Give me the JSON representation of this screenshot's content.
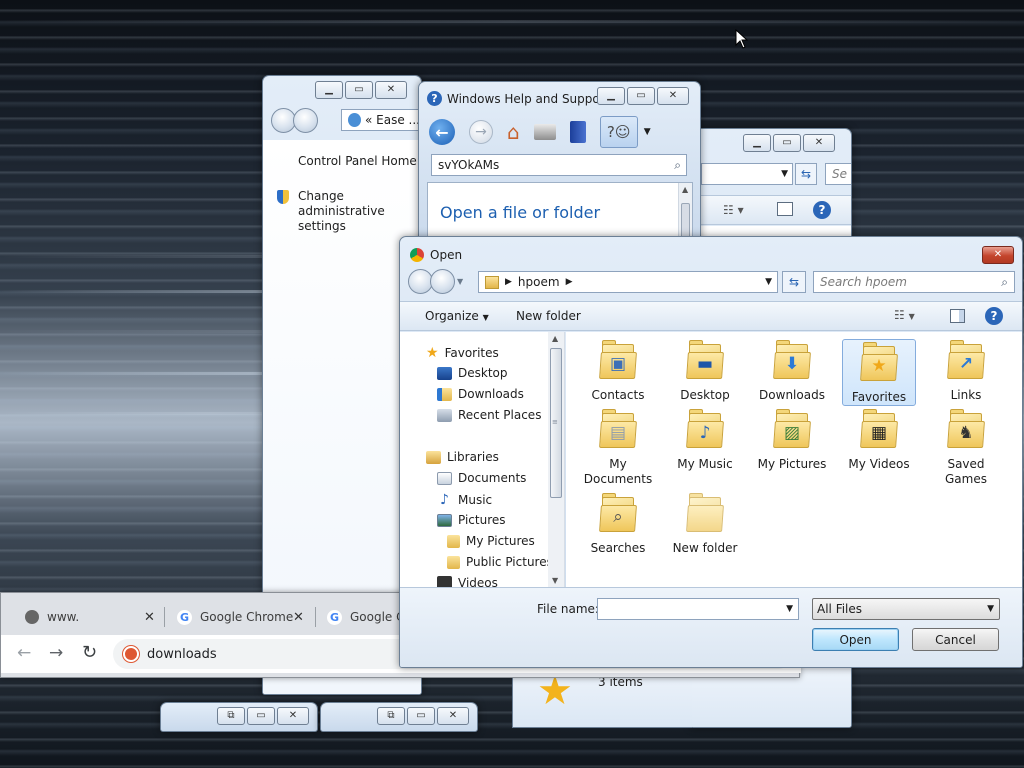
{
  "desktop": {
    "cursor": "arrow-cursor"
  },
  "control_panel": {
    "address": "Ease ...",
    "address_prefix": "«",
    "sidebar_home": "Control Panel Home",
    "sidebar_link": "Change administrative settings"
  },
  "help_window": {
    "title": "Windows Help and Support",
    "search_value": "svYOkAMs",
    "heading": "Open a file or folder"
  },
  "explorer_back": {
    "search_placeholder": "Se",
    "status": "3 items"
  },
  "open_dialog": {
    "title": "Open",
    "breadcrumb": "hpoem",
    "search_placeholder": "Search hpoem",
    "toolbar": {
      "organize": "Organize",
      "new_folder": "New folder"
    },
    "nav": {
      "favorites": "Favorites",
      "desktop": "Desktop",
      "downloads": "Downloads",
      "recent": "Recent Places",
      "libraries": "Libraries",
      "documents": "Documents",
      "music": "Music",
      "pictures": "Pictures",
      "my_pictures": "My Pictures",
      "public_pictures": "Public Pictures",
      "videos": "Videos"
    },
    "items": {
      "contacts": "Contacts",
      "desktop": "Desktop",
      "downloads": "Downloads",
      "favorites": "Favorites",
      "links": "Links",
      "my_documents": "My Documents",
      "my_music": "My Music",
      "my_pictures": "My Pictures",
      "my_videos": "My Videos",
      "saved_games": "Saved Games",
      "searches": "Searches",
      "new_folder": "New folder"
    },
    "file_name_label": "File name:",
    "file_name_value": "",
    "file_type": "All Files",
    "open_button": "Open",
    "cancel_button": "Cancel"
  },
  "chrome": {
    "tabs": [
      {
        "title": "www."
      },
      {
        "title": "Google Chrome"
      },
      {
        "title": "Google C"
      }
    ],
    "omnibox": "downloads"
  },
  "colors": {
    "selection": "#cfe5fb",
    "accent_blue": "#1c5fb0",
    "close_red": "#c4452d"
  }
}
